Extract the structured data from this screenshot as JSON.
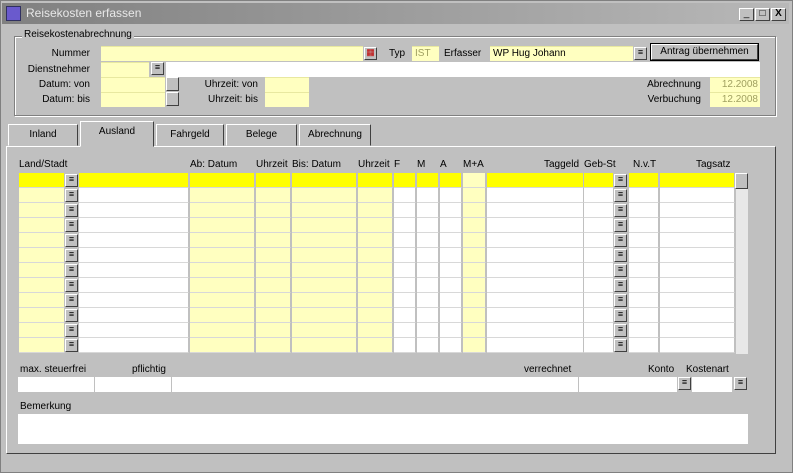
{
  "window": {
    "title": "Reisekosten erfassen",
    "min_label": "_",
    "max_label": "□",
    "close_label": "X"
  },
  "header_group": {
    "title": "Reisekostenabrechnung",
    "nummer_label": "Nummer",
    "nummer_value": "",
    "typ_label": "Typ",
    "typ_value": "IST",
    "erfasser_label": "Erfasser",
    "erfasser_value": "WP Hug Johann",
    "antrag_button": "Antrag übernehmen",
    "dienstnehmer_label": "Dienstnehmer",
    "dienstnehmer_value": "",
    "datum_von_label": "Datum: von",
    "datum_bis_label": "Datum: bis",
    "uhrzeit_von_label": "Uhrzeit: von",
    "uhrzeit_bis_label": "Uhrzeit: bis",
    "abrechnung_label": "Abrechnung",
    "abrechnung_value": "12.2008",
    "verbuchung_label": "Verbuchung",
    "verbuchung_value": "12.2008"
  },
  "tabs": [
    {
      "label": "Inland",
      "active": false
    },
    {
      "label": "Ausland",
      "active": true
    },
    {
      "label": "Fahrgeld",
      "active": false
    },
    {
      "label": "Belege",
      "active": false
    },
    {
      "label": "Abrechnung",
      "active": false
    }
  ],
  "table": {
    "columns": [
      "Land/Stadt",
      "Ab: Datum",
      "Uhrzeit",
      "Bis: Datum",
      "Uhrzeit",
      "F",
      "M",
      "A",
      "M+A",
      "Taggeld",
      "Geb-St",
      "N.v.T",
      "Tagsatz"
    ],
    "row_count": 12
  },
  "footer": {
    "max_steuerfrei_label": "max. steuerfrei",
    "pflichtig_label": "pflichtig",
    "verrechnet_label": "verrechnet",
    "konto_label": "Konto",
    "kostenart_label": "Kostenart",
    "bemerkung_label": "Bemerkung"
  },
  "icons": {
    "lov": "list-icon",
    "calendar": "calendar-icon",
    "app": "app-icon"
  }
}
